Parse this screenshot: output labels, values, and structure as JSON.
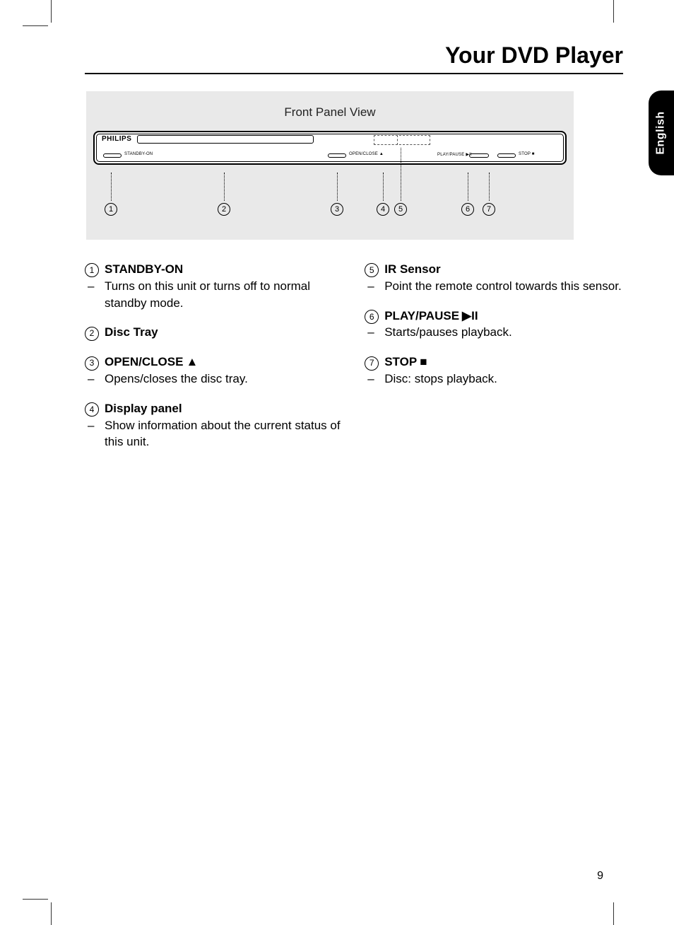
{
  "header": {
    "title": "Your DVD Player"
  },
  "lang_tab": "English",
  "page_number": "9",
  "diagram": {
    "title": "Front Panel View",
    "brand": "PHILIPS",
    "labels": {
      "standby": "STANDBY-ON",
      "openclose": "OPEN/CLOSE ▲",
      "playpause": "PLAY/PAUSE ▶II",
      "stop": "STOP ■"
    },
    "callouts": [
      "1",
      "2",
      "3",
      "4",
      "5",
      "6",
      "7"
    ]
  },
  "left": [
    {
      "num": "1",
      "title": "STANDBY-ON",
      "icon": "",
      "desc": "Turns on this unit or turns off to normal standby mode."
    },
    {
      "num": "2",
      "title": "Disc Tray",
      "icon": "",
      "desc": ""
    },
    {
      "num": "3",
      "title": "OPEN/CLOSE",
      "icon": "▲",
      "desc": "Opens/closes the disc tray."
    },
    {
      "num": "4",
      "title": "Display panel",
      "icon": "",
      "desc": "Show information about the current status of this unit."
    }
  ],
  "right": [
    {
      "num": "5",
      "title": "IR Sensor",
      "icon": "",
      "desc": "Point the remote control towards this sensor."
    },
    {
      "num": "6",
      "title": "PLAY/PAUSE",
      "icon": "▶II",
      "desc": "Starts/pauses playback."
    },
    {
      "num": "7",
      "title": "STOP",
      "icon": "■",
      "desc": "Disc: stops playback."
    }
  ]
}
